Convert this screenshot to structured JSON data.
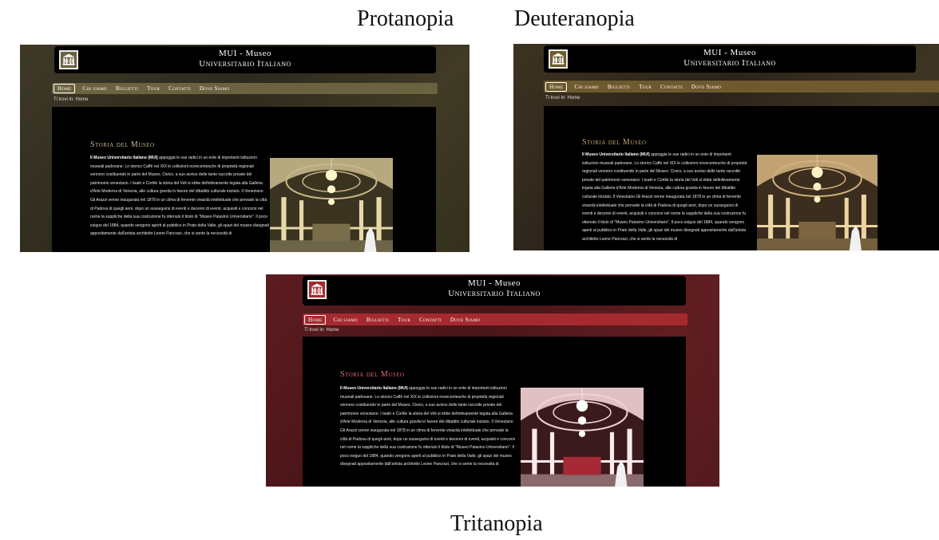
{
  "captions": {
    "protanopia": "Protanopia",
    "deuteranopia": "Deuteranopia",
    "tritanopia": "Tritanopia"
  },
  "site": {
    "logo_icon": "museum-building-icon",
    "header_line1": "MUI - Museo",
    "header_line2": "Universitario Italiano",
    "nav": [
      "Home",
      "Chi siamo",
      "Biglietti",
      "Tour",
      "Contatti",
      "Dove Siamo"
    ],
    "breadcrumb": "Ti trovi in: Home",
    "article_title": "Storia del Museo",
    "article_lead": "Il Museo Universitario Italiano (MUI)",
    "article_body": "appoggia le sue radici in un ente di importanti istituzioni museali padovane. Lo storico Caffè nel XIX le collezioni novecentesche di proprietà regionali vennero costituendo in parte del Museo. Civico, a suo avviso delle tante raccolte private del patrimonio veneziano. I teatri e Cortile la storia del Veli si ebbe definitivamente legata alla Galleria d'Arte Moderna di Venezia, alle cultura gravita in favore del dibattito culturale iniziato. Il Veneziano Gli Arazzi venne inaugurata nel 1878 in un clima di fervente vivacità intellettuale che pervade la città di Padova di quegli anni, dopo un susseguirsi di eventi e decenni di eventi, acquisiti e concorsi nel nome la suppliche della sua costruzione fu ottenuto il titolo di \"Museo Patavino Universitario\". Il poco esiguo del 1884, quando vengono aperti al pubblico in Prato della Valle, gli spazi del museo disegnati appositamente dall'artista architetto Leone Pancrazi, che si sente la necessità di"
  },
  "colors": {
    "protanopia_accent": "#6b6240",
    "protanopia_bg": "#3b3624",
    "protanopia_title": "#c8b98a",
    "deuteranopia_accent": "#6e5a2e",
    "deuteranopia_bg": "#3a3020",
    "deuteranopia_title": "#c9a870",
    "tritanopia_accent": "#a52a2f",
    "tritanopia_bg": "#5a1a1d",
    "tritanopia_title": "#e86a78"
  }
}
